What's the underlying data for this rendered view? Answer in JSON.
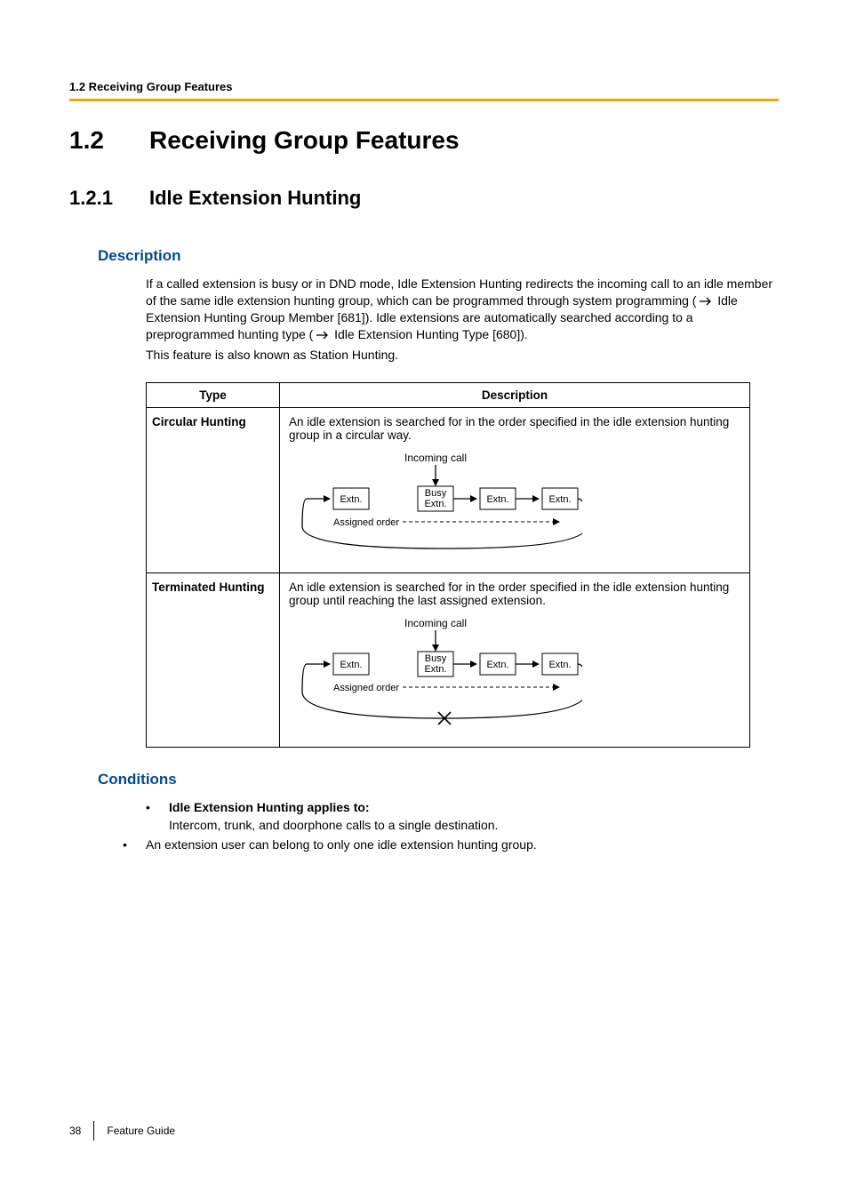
{
  "header": {
    "breadcrumb": "1.2 Receiving Group Features"
  },
  "h1": {
    "num": "1.2",
    "title": "Receiving Group Features"
  },
  "h2": {
    "num": "1.2.1",
    "title": "Idle Extension Hunting"
  },
  "description": {
    "heading": "Description",
    "p1a": "If a called extension is busy or in DND mode, Idle Extension Hunting redirects the incoming call to an idle member of the same idle extension hunting group, which can be programmed through system programming (",
    "p1b": " Idle Extension Hunting Group Member [681]). Idle extensions are automatically searched according to a preprogrammed hunting type (",
    "p1c": " Idle Extension Hunting Type [680]).",
    "p2": "This feature is also known as Station Hunting."
  },
  "table": {
    "head": {
      "type": "Type",
      "desc": "Description"
    },
    "rows": [
      {
        "type": "Circular Hunting",
        "desc": "An idle extension is searched for in the order specified in the idle extension hunting group in a circular way."
      },
      {
        "type": "Terminated Hunting",
        "desc": "An idle extension is searched for in the order specified in the idle extension hunting group until reaching the last assigned extension."
      }
    ],
    "diagram": {
      "incoming": "Incoming call",
      "extn": "Extn.",
      "busy1": "Busy",
      "busy2": "Extn.",
      "assigned": "Assigned order"
    }
  },
  "conditions": {
    "heading": "Conditions",
    "b1_lead": "Idle Extension Hunting applies to:",
    "b1_body": "Intercom, trunk, and doorphone calls to a single destination.",
    "b2": "An extension user can belong to only one idle extension hunting group."
  },
  "footer": {
    "page": "38",
    "label": "Feature Guide"
  }
}
